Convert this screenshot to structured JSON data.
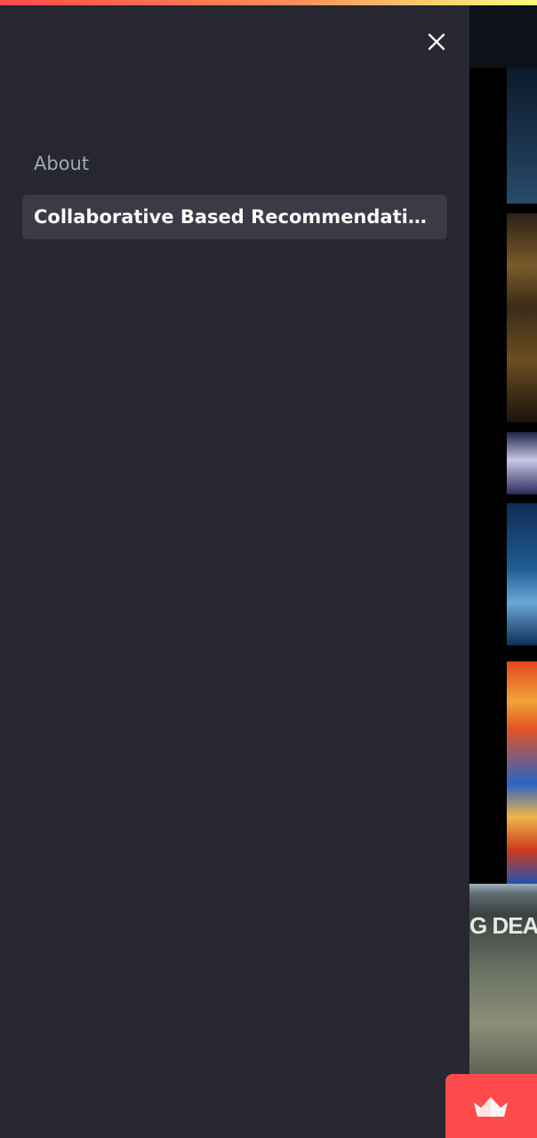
{
  "sidebar": {
    "nav_items": [
      {
        "label": "About",
        "active": false
      },
      {
        "label": "Collaborative Based Recommendation …",
        "active": true
      }
    ],
    "close_icon": "close-icon"
  },
  "header": {
    "menu_icon": "hamburger-menu-icon"
  },
  "background_poster_text": "G DEAD",
  "colors": {
    "sidebar_bg": "#262730",
    "active_item_bg": "#3a3b47",
    "accent": "#ff4b4b",
    "app_bg": "#0e1117"
  }
}
